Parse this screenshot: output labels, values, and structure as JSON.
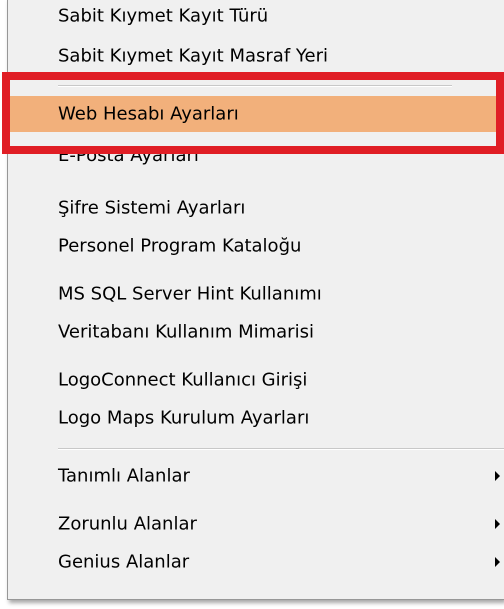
{
  "menu": {
    "items": [
      {
        "label": "Sabit Kıymet Kayıt Türü"
      },
      {
        "label": "Sabit Kıymet Kayıt Masraf Yeri"
      },
      {
        "label": "Web Hesabı Ayarları"
      },
      {
        "label": "E-Posta Ayarları"
      },
      {
        "label": "Şifre Sistemi Ayarları"
      },
      {
        "label": "Personel Program Kataloğu"
      },
      {
        "label": "MS SQL Server Hint Kullanımı"
      },
      {
        "label": "Veritabanı Kullanım Mimarisi"
      },
      {
        "label": "LogoConnect Kullanıcı Girişi"
      },
      {
        "label": "Logo Maps Kurulum Ayarları"
      },
      {
        "label": "Tanımlı Alanlar"
      },
      {
        "label": "Zorunlu Alanlar"
      },
      {
        "label": "Genius Alanlar"
      }
    ],
    "highlighted_item": "Web Hesabı Ayarları",
    "submenu_items": [
      "Tanımlı Alanlar",
      "Zorunlu Alanlar",
      "Genius Alanlar"
    ]
  },
  "colors": {
    "menu_background": "#f0f0f0",
    "highlight": "#f2b07b",
    "annotation": "#e01e25"
  }
}
